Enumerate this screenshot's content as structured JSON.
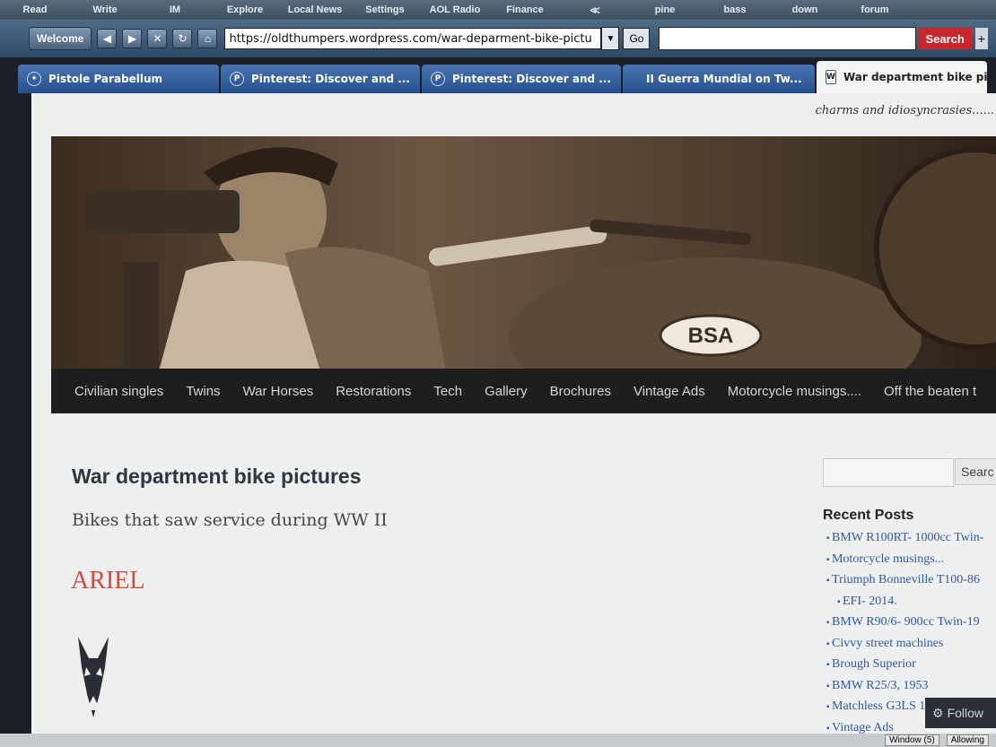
{
  "toolbar": {
    "items": [
      "Read",
      "Write",
      "IM",
      "Explore",
      "Local News",
      "Settings",
      "AOL Radio",
      "Finance",
      "≪",
      "pine",
      "bass",
      "down",
      "forum"
    ]
  },
  "navbar": {
    "welcome_label": "Welcome",
    "url": "https://oldthumpers.wordpress.com/war-deparment-bike-pictu",
    "go_label": "Go",
    "search_label": "Search",
    "plus_label": "+"
  },
  "tabs": [
    {
      "label": "Pistole Parabellum"
    },
    {
      "label": "Pinterest: Discover and ..."
    },
    {
      "label": "Pinterest: Discover and ..."
    },
    {
      "label": "II Guerra Mundial on Tw..."
    },
    {
      "label": "War department bike pi..."
    }
  ],
  "site": {
    "tagline": "charms and idiosyncrasies......",
    "header_badge": "BSA",
    "menu": [
      "Civilian singles",
      "Twins",
      "War Horses",
      "Restorations",
      "Tech",
      "Gallery",
      "Brochures",
      "Vintage Ads",
      "Motorcycle musings....",
      "Off the beaten t"
    ]
  },
  "post": {
    "title": "War department bike pictures",
    "subtitle": "Bikes that saw service during WW II",
    "section_heading": "ARIEL"
  },
  "sidebar": {
    "search_label": "Searc",
    "recent_heading": "Recent Posts",
    "recent_posts": [
      "BMW R100RT- 1000cc Twin-",
      "Motorcycle musings...",
      "Triumph Bonneville T100-86",
      "EFI- 2014.",
      "BMW R90/6- 900cc Twin-19",
      "Civvy street machines",
      "Brough Superior",
      "BMW R25/3, 1953",
      "Matchless G3LS 195",
      "Vintage Ads"
    ],
    "follow_label": "Follow"
  },
  "statusbar": {
    "window_label": "Window (5)",
    "allow_label": "Allowing"
  }
}
